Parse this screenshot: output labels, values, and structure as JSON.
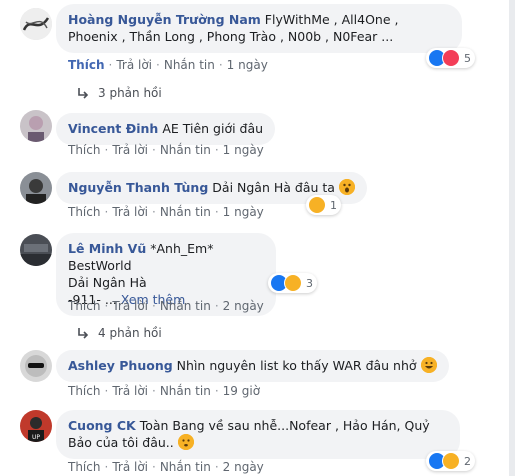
{
  "comments": [
    {
      "name": "Hoàng Nguyễn Trường Nam",
      "text": "FlyWithMe , All4One , Phoenix , Thần Long , Phong Trào , N00b , N0Fear ...",
      "like": "Thích",
      "reply": "Trả lời",
      "message": "Nhắn tin",
      "time": "1 ngày",
      "reaction_count": "5",
      "replies_label": "3 phản hồi"
    },
    {
      "name": "Vincent Đinh",
      "text": "AE Tiên giới đâu",
      "like": "Thích",
      "reply": "Trả lời",
      "message": "Nhắn tin",
      "time": "1 ngày"
    },
    {
      "name": "Nguyễn Thanh Tùng",
      "text": "Dải Ngân Hà đâu ta",
      "like": "Thích",
      "reply": "Trả lời",
      "message": "Nhắn tin",
      "time": "1 ngày",
      "reaction_count": "1"
    },
    {
      "name": "Lê Minh Vũ",
      "text_line1": "*Anh_Em* BestWorld",
      "text_line2": "Dải Ngân Hà",
      "text_line3": "-911- ...",
      "see_more": "Xem thêm",
      "like": "Thích",
      "reply": "Trả lời",
      "message": "Nhắn tin",
      "time": "2 ngày",
      "reaction_count": "3",
      "replies_label": "4 phản hồi"
    },
    {
      "name": "Ashley Phuong",
      "text": "Nhìn nguyên list ko thấy WAR đâu nhở",
      "like": "Thích",
      "reply": "Trả lời",
      "message": "Nhắn tin",
      "time": "19 giờ"
    },
    {
      "name": "Cuong CK",
      "text": "Toàn Bang về sau nhễ...Nofear , Hảo Hán, Quỷ Bảo của tôi đâu..",
      "like": "Thích",
      "reply": "Trả lời",
      "message": "Nhắn tin",
      "time": "2 ngày",
      "reaction_count": "2"
    }
  ],
  "colors": {
    "name": "#385898",
    "bubble": "#f2f3f5",
    "meta": "#606770",
    "like_active": "#4267b2"
  }
}
